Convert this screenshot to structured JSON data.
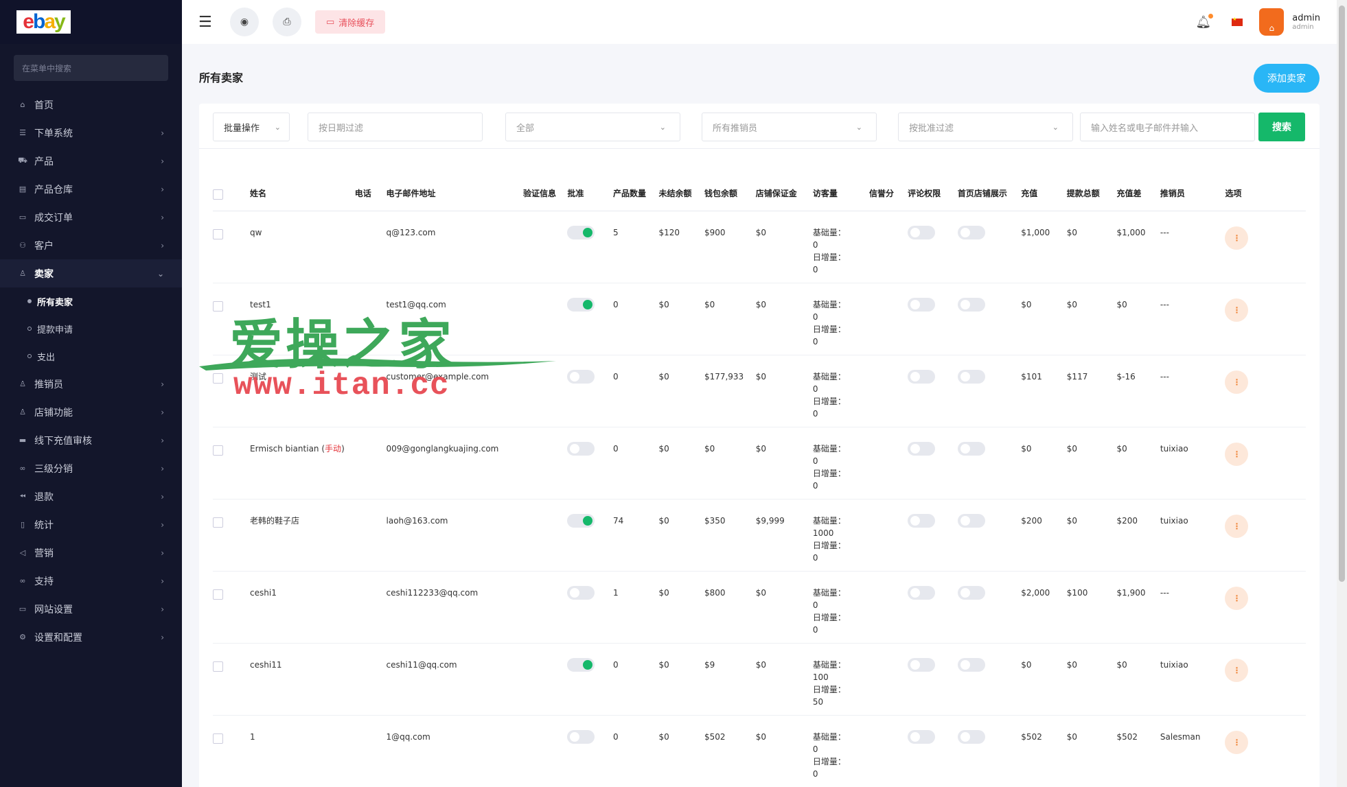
{
  "sidebar": {
    "search_placeholder": "在菜单中搜索",
    "items": [
      {
        "label": "首页",
        "icon": "home-icon",
        "has_children": false
      },
      {
        "label": "下单系统",
        "icon": "list-icon",
        "has_children": true
      },
      {
        "label": "产品",
        "icon": "cart-icon",
        "has_children": true
      },
      {
        "label": "产品仓库",
        "icon": "archive-icon",
        "has_children": true
      },
      {
        "label": "成交订单",
        "icon": "ticket-icon",
        "has_children": true
      },
      {
        "label": "客户",
        "icon": "users-icon",
        "has_children": true
      },
      {
        "label": "卖家",
        "icon": "user-icon",
        "has_children": true,
        "active": true
      },
      {
        "label": "推销员",
        "icon": "user-icon",
        "has_children": true
      },
      {
        "label": "店铺功能",
        "icon": "user-icon",
        "has_children": true
      },
      {
        "label": "线下充值审核",
        "icon": "card-icon",
        "has_children": true
      },
      {
        "label": "三级分销",
        "icon": "link-icon",
        "has_children": true
      },
      {
        "label": "退款",
        "icon": "rewind-icon",
        "has_children": true
      },
      {
        "label": "统计",
        "icon": "file-icon",
        "has_children": true
      },
      {
        "label": "营销",
        "icon": "megaphone-icon",
        "has_children": true
      },
      {
        "label": "支持",
        "icon": "link-icon",
        "has_children": true
      },
      {
        "label": "网站设置",
        "icon": "monitor-icon",
        "has_children": true
      },
      {
        "label": "设置和配置",
        "icon": "gear-icon",
        "has_children": true
      }
    ],
    "submenu": [
      {
        "label": "所有卖家",
        "active": true
      },
      {
        "label": "提款申请",
        "active": false
      },
      {
        "label": "支出",
        "active": false
      }
    ]
  },
  "topbar": {
    "clear_cache": "清除缓存",
    "user_name": "admin",
    "user_role": "admin"
  },
  "page": {
    "title": "所有卖家",
    "add_button": "添加卖家"
  },
  "filters": {
    "bulk": "批量操作",
    "date_placeholder": "按日期过滤",
    "all": "全部",
    "promoter": "所有推销员",
    "approve": "按批准过滤",
    "search_placeholder": "输入姓名或电子邮件并输入",
    "search_button": "搜索"
  },
  "table": {
    "headers": [
      "姓名",
      "电话",
      "电子邮件地址",
      "验证信息",
      "批准",
      "产品数量",
      "未结余额",
      "钱包余额",
      "店铺保证金",
      "访客量",
      "信誉分",
      "评论权限",
      "首页店铺展示",
      "充值",
      "提款总额",
      "充值差",
      "推销员",
      "选项"
    ],
    "visitor_labels": {
      "base": "基础量：",
      "daily": "日增量："
    },
    "rows": [
      {
        "name": "qw",
        "name_tag": "",
        "email": "q@123.com",
        "approved": true,
        "products": "5",
        "unsettled": "$120",
        "wallet": "$900",
        "deposit": "$0",
        "base": "0",
        "daily": "0",
        "recharge": "$1,000",
        "withdraw": "$0",
        "diff": "$1,000",
        "promoter": "---"
      },
      {
        "name": "test1",
        "name_tag": "",
        "email": "test1@qq.com",
        "approved": true,
        "products": "0",
        "unsettled": "$0",
        "wallet": "$0",
        "deposit": "$0",
        "base": "0",
        "daily": "0",
        "recharge": "$0",
        "withdraw": "$0",
        "diff": "$0",
        "promoter": "---"
      },
      {
        "name": "测试",
        "name_tag": "",
        "email": "customer@example.com",
        "approved": false,
        "products": "0",
        "unsettled": "$0",
        "wallet": "$177,933",
        "deposit": "$0",
        "base": "0",
        "daily": "0",
        "recharge": "$101",
        "withdraw": "$117",
        "diff": "$-16",
        "promoter": "---"
      },
      {
        "name": "Ermisch biantian (",
        "name_tag": "手动",
        "email": "009@gonglangkuajing.com",
        "approved": false,
        "products": "0",
        "unsettled": "$0",
        "wallet": "$0",
        "deposit": "$0",
        "base": "0",
        "daily": "0",
        "recharge": "$0",
        "withdraw": "$0",
        "diff": "$0",
        "promoter": "tuixiao"
      },
      {
        "name": "老韩的鞋子店",
        "name_tag": "",
        "email": "laoh@163.com",
        "approved": true,
        "products": "74",
        "unsettled": "$0",
        "wallet": "$350",
        "deposit": "$9,999",
        "base": "1000",
        "daily": "0",
        "recharge": "$200",
        "withdraw": "$0",
        "diff": "$200",
        "promoter": "tuixiao"
      },
      {
        "name": "ceshi1",
        "name_tag": "",
        "email": "ceshi112233@qq.com",
        "approved": false,
        "products": "1",
        "unsettled": "$0",
        "wallet": "$800",
        "deposit": "$0",
        "base": "0",
        "daily": "0",
        "recharge": "$2,000",
        "withdraw": "$100",
        "diff": "$1,900",
        "promoter": "---"
      },
      {
        "name": "ceshi11",
        "name_tag": "",
        "email": "ceshi11@qq.com",
        "approved": true,
        "products": "0",
        "unsettled": "$0",
        "wallet": "$9",
        "deposit": "$0",
        "base": "100",
        "daily": "50",
        "recharge": "$0",
        "withdraw": "$0",
        "diff": "$0",
        "promoter": "tuixiao"
      },
      {
        "name": "1",
        "name_tag": "",
        "email": "1@qq.com",
        "approved": false,
        "products": "0",
        "unsettled": "$0",
        "wallet": "$502",
        "deposit": "$0",
        "base": "0",
        "daily": "0",
        "recharge": "$502",
        "withdraw": "$0",
        "diff": "$502",
        "promoter": "Salesman"
      }
    ]
  },
  "watermark": {
    "line1": "爱操之家",
    "line2": "www.itan.cc"
  },
  "colors": {
    "sidebar_bg": "#13162b",
    "accent_green": "#15b86a",
    "accent_blue": "#29b6f6",
    "danger_pink": "#fde4e6"
  }
}
